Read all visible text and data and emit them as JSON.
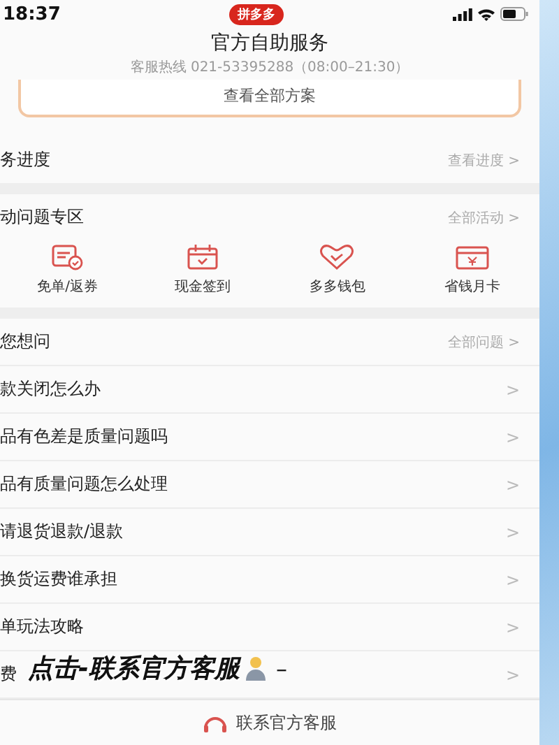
{
  "status_bar": {
    "time": "18:37",
    "app_badge": "拼多多"
  },
  "header": {
    "title": "官方自助服务",
    "hotline": "客服热线 021-53395288（08:00–21:30）",
    "plan_link": "查看全部方案"
  },
  "progress": {
    "title": "务进度",
    "link": "查看进度 >"
  },
  "activities": {
    "title": "动问题专区",
    "link": "全部活动 >",
    "items": [
      {
        "kind": "coupon",
        "label": "免单/返券"
      },
      {
        "kind": "calendar",
        "label": "现金签到"
      },
      {
        "kind": "heart",
        "label": "多多钱包"
      },
      {
        "kind": "card",
        "label": "省钱月卡"
      }
    ]
  },
  "questions": {
    "title": "您想问",
    "link": "全部问题 >",
    "items": [
      {
        "text": "款关闭怎么办",
        "arrow": ">"
      },
      {
        "text": "品有色差是质量问题吗",
        "arrow": ">"
      },
      {
        "text": "品有质量问题怎么处理",
        "arrow": ">"
      },
      {
        "text": "请退货退款/退款",
        "arrow": ">"
      },
      {
        "text": "换货运费谁承担",
        "arrow": ">"
      },
      {
        "text": "单玩法攻略",
        "arrow": ">"
      },
      {
        "text": "费",
        "arrow": ">"
      }
    ]
  },
  "caption": {
    "text": "点击-联系官方客服",
    "tail": "–"
  },
  "bottom_bar": {
    "label": "联系官方客服"
  }
}
